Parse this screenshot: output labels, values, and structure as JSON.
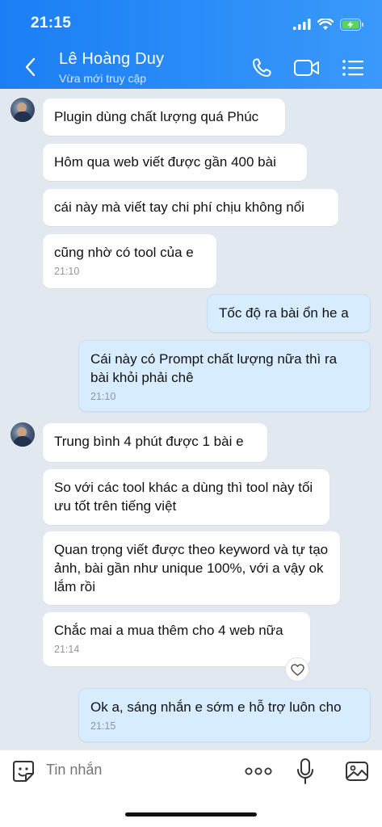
{
  "status_bar": {
    "time": "21:15"
  },
  "header": {
    "contact_name": "Lê Hoàng Duy",
    "contact_status": "Vừa mới truy cập"
  },
  "messages": [
    {
      "text": "Plugin dùng chất lượng quá Phúc"
    },
    {
      "text": "Hôm qua web viết được gần 400 bài"
    },
    {
      "text": "cái này mà viết tay chi phí chịu không nổi"
    },
    {
      "text": "cũng nhờ có tool của e",
      "time": "21:10"
    },
    {
      "text": "Tốc độ ra bài ổn he a"
    },
    {
      "text": "Cái này có Prompt chất lượng nữa thì ra bài khỏi phải chê",
      "time": "21:10"
    },
    {
      "text": "Trung bình 4 phút được 1 bài e"
    },
    {
      "text": "So với các tool khác a dùng thì tool này tối ưu tốt trên tiếng việt"
    },
    {
      "text": "Quan trọng viết được theo keyword và tự tạo ảnh, bài gần như unique 100%, với a vậy ok lắm rồi"
    },
    {
      "text": "Chắc mai a mua thêm cho 4 web nữa",
      "time": "21:14"
    },
    {
      "text": "Ok a, sáng nhắn e sớm e hỗ trợ luôn cho",
      "time": "21:15"
    }
  ],
  "input": {
    "placeholder": "Tin nhắn"
  },
  "icons": {
    "back": "chevron-left-icon",
    "call": "phone-icon",
    "video": "video-camera-icon",
    "menu": "list-menu-icon",
    "sticker": "smiley-sticker-icon",
    "more": "more-dots-icon",
    "mic": "microphone-icon",
    "gallery": "image-gallery-icon",
    "react": "heart-icon"
  },
  "colors": {
    "header": "#2b8df8",
    "outgoing_bubble": "#d7ecff",
    "incoming_bubble": "#ffffff",
    "background": "#e2e8ef"
  }
}
